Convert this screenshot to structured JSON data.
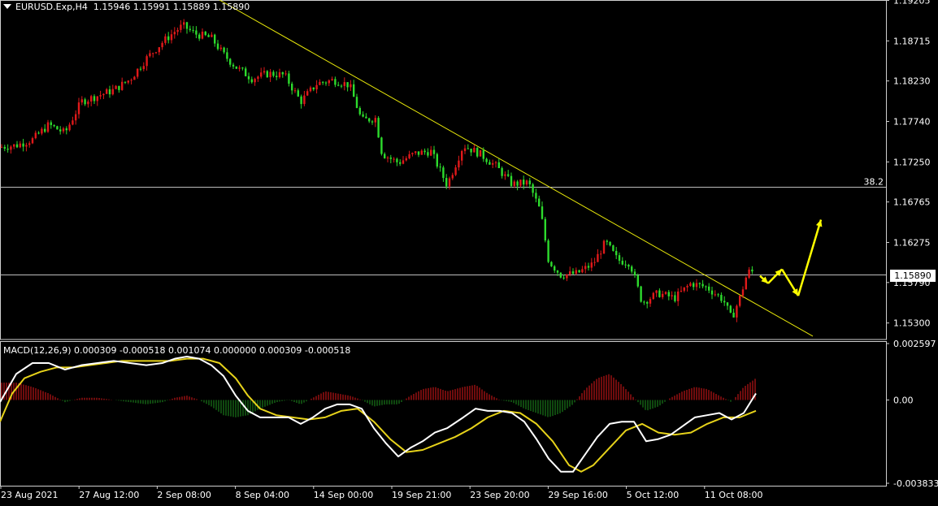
{
  "header": {
    "symbol_timeframe": "EURUSD.Exp,H4",
    "ohlc": "1.15946 1.15991 1.15889 1.15890"
  },
  "macd": {
    "title": "MACD(12,26,9) 0.000309 -0.000518 0.001074 0.000000 0.000309 -0.000518",
    "axis_ticks": [
      "0.002597",
      "0.00",
      "-0.003833"
    ]
  },
  "fib_label": "38.2",
  "current_price_label": "1.15890",
  "colors": {
    "bull": "#e0191a",
    "bear": "#2ddb2d",
    "trendline": "#e8e80a",
    "signal": "#e6d21a",
    "macd_line": "#ffffff",
    "arrow": "#ffff00",
    "hline": "#bdbdbd"
  },
  "chart_data": {
    "type": "candlestick",
    "instrument": "EURUSD.Exp",
    "timeframe": "H4",
    "price_axis": {
      "ylim": [
        1.151,
        1.1921
      ],
      "ticks": [
        "1.19205",
        "1.18715",
        "1.18230",
        "1.17740",
        "1.17250",
        "1.16765",
        "1.16275",
        "1.15790",
        "1.15300"
      ]
    },
    "time_axis": {
      "ticks": [
        "23 Aug 2021",
        "27 Aug 12:00",
        "2 Sep 08:00",
        "8 Sep 04:00",
        "14 Sep 00:00",
        "19 Sep 21:00",
        "23 Sep 20:00",
        "29 Sep 16:00",
        "5 Oct 12:00",
        "11 Oct 08:00"
      ]
    },
    "close_path": [
      [
        0,
        1.1743
      ],
      [
        20,
        1.1745
      ],
      [
        40,
        1.1752
      ],
      [
        60,
        1.177
      ],
      [
        80,
        1.176
      ],
      [
        100,
        1.1798
      ],
      [
        120,
        1.1805
      ],
      [
        140,
        1.1812
      ],
      [
        160,
        1.1825
      ],
      [
        180,
        1.185
      ],
      [
        200,
        1.187
      ],
      [
        215,
        1.1883
      ],
      [
        225,
        1.189
      ],
      [
        240,
        1.188
      ],
      [
        260,
        1.1875
      ],
      [
        275,
        1.1855
      ],
      [
        290,
        1.184
      ],
      [
        310,
        1.1826
      ],
      [
        330,
        1.1832
      ],
      [
        350,
        1.183
      ],
      [
        370,
        1.1798
      ],
      [
        390,
        1.182
      ],
      [
        410,
        1.1824
      ],
      [
        430,
        1.1818
      ],
      [
        445,
        1.1775
      ],
      [
        462,
        1.1778
      ],
      [
        470,
        1.1735
      ],
      [
        490,
        1.1724
      ],
      [
        510,
        1.1735
      ],
      [
        530,
        1.1738
      ],
      [
        550,
        1.1697
      ],
      [
        570,
        1.1745
      ],
      [
        590,
        1.1735
      ],
      [
        610,
        1.172
      ],
      [
        630,
        1.1698
      ],
      [
        650,
        1.17
      ],
      [
        665,
        1.1665
      ],
      [
        675,
        1.1605
      ],
      [
        690,
        1.1588
      ],
      [
        710,
        1.159
      ],
      [
        730,
        1.1602
      ],
      [
        745,
        1.1628
      ],
      [
        760,
        1.1606
      ],
      [
        775,
        1.1603
      ],
      [
        790,
        1.1555
      ],
      [
        810,
        1.1566
      ],
      [
        830,
        1.156
      ],
      [
        850,
        1.1578
      ],
      [
        870,
        1.1573
      ],
      [
        890,
        1.1558
      ],
      [
        900,
        1.1535
      ],
      [
        910,
        1.156
      ],
      [
        920,
        1.1592
      ],
      [
        928,
        1.1592
      ]
    ],
    "trendline": {
      "from": [
        270,
        1.1921
      ],
      "to": [
        1000,
        1.1514
      ]
    },
    "horizontal_levels": [
      {
        "label": "38.2",
        "price": 1.1695
      },
      {
        "label": "",
        "price": 1.1589
      }
    ],
    "projection_arrows": [
      {
        "from": [
          935,
          1.1587
        ],
        "to": [
          945,
          1.1578
        ]
      },
      {
        "from": [
          945,
          1.1578
        ],
        "to": [
          962,
          1.1595
        ]
      },
      {
        "from": [
          962,
          1.1595
        ],
        "to": [
          982,
          1.1563
        ]
      },
      {
        "from": [
          982,
          1.1563
        ],
        "to": [
          1010,
          1.1655
        ]
      }
    ],
    "macd_panel": {
      "ylim": [
        -0.003833,
        0.002597
      ],
      "macd_line": [
        [
          0,
          -0.0001
        ],
        [
          20,
          0.0012
        ],
        [
          40,
          0.0017
        ],
        [
          60,
          0.0017
        ],
        [
          80,
          0.0014
        ],
        [
          100,
          0.0016
        ],
        [
          120,
          0.0017
        ],
        [
          140,
          0.0018
        ],
        [
          160,
          0.0017
        ],
        [
          180,
          0.0016
        ],
        [
          200,
          0.0017
        ],
        [
          215,
          0.0019
        ],
        [
          230,
          0.002
        ],
        [
          245,
          0.0019
        ],
        [
          260,
          0.0016
        ],
        [
          275,
          0.0011
        ],
        [
          290,
          0.0002
        ],
        [
          305,
          -0.0005
        ],
        [
          320,
          -0.0008
        ],
        [
          340,
          -0.0008
        ],
        [
          355,
          -0.0008
        ],
        [
          370,
          -0.0011
        ],
        [
          385,
          -0.0008
        ],
        [
          400,
          -0.0004
        ],
        [
          415,
          -0.0002
        ],
        [
          430,
          -0.0002
        ],
        [
          445,
          -0.0004
        ],
        [
          460,
          -0.0013
        ],
        [
          475,
          -0.002
        ],
        [
          490,
          -0.0026
        ],
        [
          505,
          -0.0022
        ],
        [
          520,
          -0.0019
        ],
        [
          535,
          -0.0015
        ],
        [
          550,
          -0.0013
        ],
        [
          570,
          -0.0008
        ],
        [
          585,
          -0.0004
        ],
        [
          600,
          -0.0005
        ],
        [
          615,
          -0.0005
        ],
        [
          630,
          -0.0006
        ],
        [
          645,
          -0.001
        ],
        [
          660,
          -0.0018
        ],
        [
          675,
          -0.0027
        ],
        [
          690,
          -0.0033
        ],
        [
          705,
          -0.0033
        ],
        [
          720,
          -0.0025
        ],
        [
          735,
          -0.0017
        ],
        [
          750,
          -0.0011
        ],
        [
          765,
          -0.001
        ],
        [
          780,
          -0.001
        ],
        [
          795,
          -0.0019
        ],
        [
          810,
          -0.0018
        ],
        [
          825,
          -0.0016
        ],
        [
          840,
          -0.0012
        ],
        [
          855,
          -0.0008
        ],
        [
          870,
          -0.0007
        ],
        [
          885,
          -0.0006
        ],
        [
          900,
          -0.0009
        ],
        [
          915,
          -0.0006
        ],
        [
          930,
          0.0003
        ]
      ],
      "signal_line": [
        [
          0,
          -0.001
        ],
        [
          15,
          0.0003
        ],
        [
          30,
          0.001
        ],
        [
          50,
          0.0013
        ],
        [
          70,
          0.0015
        ],
        [
          90,
          0.0015
        ],
        [
          110,
          0.0016
        ],
        [
          130,
          0.0017
        ],
        [
          150,
          0.0018
        ],
        [
          170,
          0.0018
        ],
        [
          190,
          0.0018
        ],
        [
          210,
          0.0018
        ],
        [
          230,
          0.0019
        ],
        [
          250,
          0.0019
        ],
        [
          270,
          0.0017
        ],
        [
          290,
          0.001
        ],
        [
          305,
          0.0002
        ],
        [
          320,
          -0.0004
        ],
        [
          340,
          -0.0007
        ],
        [
          360,
          -0.0008
        ],
        [
          380,
          -0.0009
        ],
        [
          400,
          -0.0008
        ],
        [
          420,
          -0.0005
        ],
        [
          440,
          -0.0004
        ],
        [
          460,
          -0.001
        ],
        [
          480,
          -0.0018
        ],
        [
          500,
          -0.0024
        ],
        [
          520,
          -0.0023
        ],
        [
          540,
          -0.002
        ],
        [
          560,
          -0.0017
        ],
        [
          580,
          -0.0013
        ],
        [
          600,
          -0.0008
        ],
        [
          620,
          -0.0005
        ],
        [
          640,
          -0.0006
        ],
        [
          660,
          -0.0011
        ],
        [
          680,
          -0.0019
        ],
        [
          700,
          -0.003
        ],
        [
          715,
          -0.0033
        ],
        [
          730,
          -0.003
        ],
        [
          750,
          -0.0022
        ],
        [
          770,
          -0.0014
        ],
        [
          790,
          -0.0011
        ],
        [
          810,
          -0.0015
        ],
        [
          830,
          -0.0016
        ],
        [
          850,
          -0.0015
        ],
        [
          870,
          -0.0011
        ],
        [
          890,
          -0.0008
        ],
        [
          910,
          -0.0008
        ],
        [
          930,
          -0.0005
        ]
      ],
      "histogram": [
        [
          0,
          0.0008
        ],
        [
          20,
          0.0008
        ],
        [
          40,
          0.0006
        ],
        [
          60,
          0.0003
        ],
        [
          80,
          -0.0001
        ],
        [
          100,
          0.0001
        ],
        [
          120,
          0.0001
        ],
        [
          140,
          0.0
        ],
        [
          160,
          -0.0001
        ],
        [
          180,
          -0.0002
        ],
        [
          200,
          -0.0001
        ],
        [
          215,
          0.0001
        ],
        [
          230,
          0.0002
        ],
        [
          245,
          0.0
        ],
        [
          260,
          -0.0003
        ],
        [
          275,
          -0.0007
        ],
        [
          290,
          -0.0008
        ],
        [
          305,
          -0.0007
        ],
        [
          320,
          -0.0004
        ],
        [
          340,
          -0.0001
        ],
        [
          355,
          0.0
        ],
        [
          370,
          -0.0002
        ],
        [
          385,
          0.0001
        ],
        [
          400,
          0.0004
        ],
        [
          415,
          0.0003
        ],
        [
          430,
          0.0002
        ],
        [
          445,
          0.0
        ],
        [
          460,
          -0.0003
        ],
        [
          475,
          -0.0002
        ],
        [
          490,
          -0.0002
        ],
        [
          505,
          0.0002
        ],
        [
          520,
          0.0005
        ],
        [
          535,
          0.0006
        ],
        [
          550,
          0.0004
        ],
        [
          570,
          0.0006
        ],
        [
          585,
          0.0007
        ],
        [
          600,
          0.0003
        ],
        [
          615,
          0.0
        ],
        [
          630,
          -0.0001
        ],
        [
          645,
          -0.0004
        ],
        [
          660,
          -0.0006
        ],
        [
          675,
          -0.0008
        ],
        [
          690,
          -0.0006
        ],
        [
          705,
          -0.0002
        ],
        [
          720,
          0.0005
        ],
        [
          735,
          0.001
        ],
        [
          750,
          0.0012
        ],
        [
          765,
          0.0007
        ],
        [
          780,
          0.0001
        ],
        [
          795,
          -0.0005
        ],
        [
          810,
          -0.0003
        ],
        [
          825,
          0.0001
        ],
        [
          840,
          0.0004
        ],
        [
          855,
          0.0006
        ],
        [
          870,
          0.0005
        ],
        [
          885,
          0.0002
        ],
        [
          900,
          -0.0001
        ],
        [
          915,
          0.0006
        ],
        [
          930,
          0.001
        ]
      ]
    }
  }
}
